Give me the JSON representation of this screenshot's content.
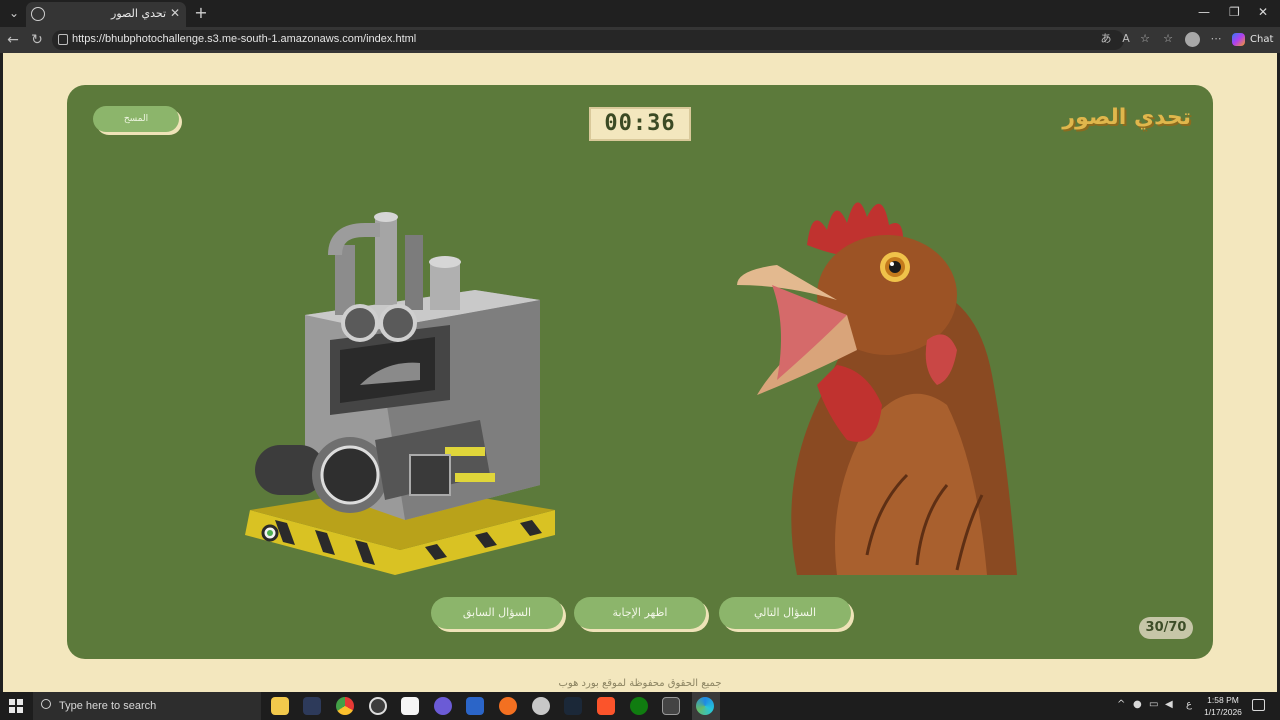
{
  "browser": {
    "tab_title": "تحدي الصور",
    "url": "https://bhubphotochallenge.s3.me-south-1.amazonaws.com/index.html",
    "chat_label": "Chat"
  },
  "game": {
    "title": "تحدي الصور",
    "reset_label": "المسح",
    "timer": "00:36",
    "prev_label": "السؤال السابق",
    "answer_label": "اظهر الإجابة",
    "next_label": "السؤال التالي",
    "counter": "30/70",
    "left_image": "machine-image",
    "right_image": "chicken-image"
  },
  "footer": {
    "text": "جميع الحقوق محفوظة لموقع بورد هوب"
  },
  "taskbar": {
    "search_placeholder": "Type here to search",
    "time": "1:58 PM",
    "date": "1/17/2026",
    "lang": "ع"
  },
  "colors": {
    "page_bg": "#f3e7be",
    "board_bg": "#5c7a3b",
    "button_bg": "#8cb56b",
    "title_color": "#e0b74c"
  }
}
